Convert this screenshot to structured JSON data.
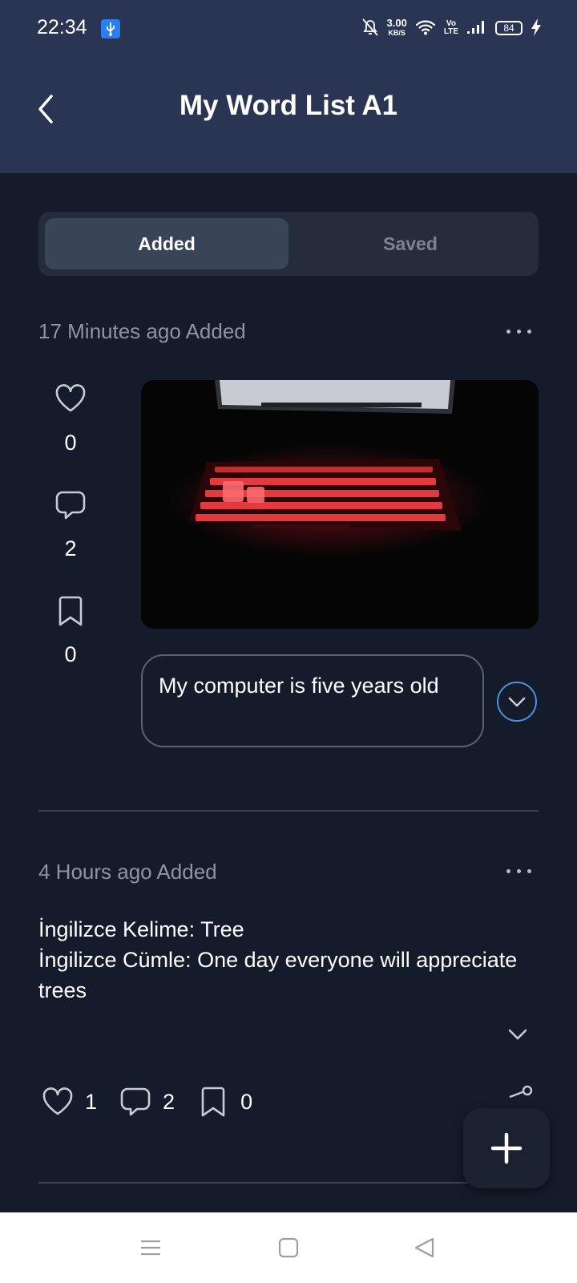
{
  "status_bar": {
    "time": "22:34",
    "net_speed_value": "3.00",
    "net_speed_unit": "KB/S",
    "volte_top": "Vo",
    "volte_bottom": "LTE",
    "battery": "84",
    "icons": [
      "usb-icon",
      "mute-icon",
      "wifi-icon",
      "signal-icon",
      "battery-icon",
      "charging-icon"
    ]
  },
  "header": {
    "title": "My Word List A1",
    "back_icon": "chevron-left-icon"
  },
  "tabs": [
    {
      "label": "Added",
      "active": true
    },
    {
      "label": "Saved",
      "active": false
    }
  ],
  "posts": [
    {
      "meta": "17 Minutes ago Added",
      "likes": "0",
      "comments": "2",
      "saves": "0",
      "sentence": "My computer is five years old",
      "image": "photo of red-backlit laptop keyboard in the dark"
    },
    {
      "meta": "4 Hours ago Added",
      "text_line1": "İngilizce Kelime: Tree",
      "text_line2": "İngilizce Cümle: One day everyone will appreciate trees",
      "likes": "1",
      "comments": "2",
      "saves": "0"
    }
  ],
  "fab": {
    "icon": "plus-icon"
  },
  "nav_bar": {
    "icons": [
      "menu-icon",
      "home-square-icon",
      "back-triangle-icon"
    ]
  },
  "colors": {
    "header_bg": "#2a3553",
    "page_bg": "#141b2b",
    "accent_blue": "#4f8fe0",
    "muted_text": "#8d95a4"
  }
}
